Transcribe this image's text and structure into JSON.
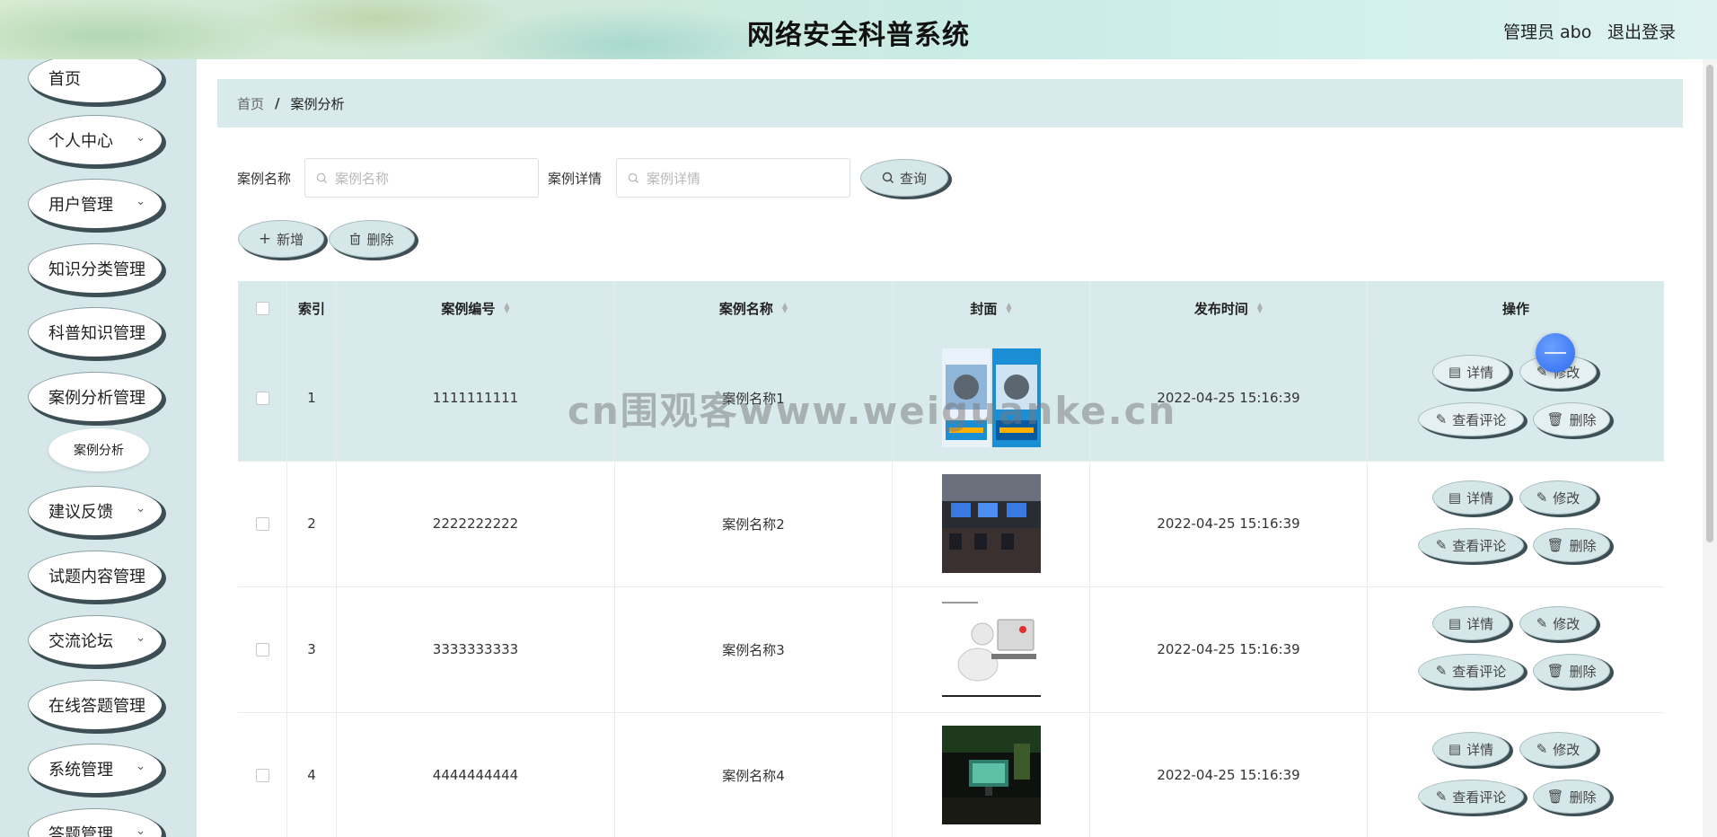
{
  "header": {
    "title": "网络安全科普系统",
    "user": "管理员 abo",
    "logout": "退出登录"
  },
  "sidebar": {
    "items": [
      {
        "label": "首页",
        "has_arrow": false
      },
      {
        "label": "个人中心",
        "has_arrow": true
      },
      {
        "label": "用户管理",
        "has_arrow": true
      },
      {
        "label": "知识分类管理",
        "has_arrow": false
      },
      {
        "label": "科普知识管理",
        "has_arrow": false
      },
      {
        "label": "案例分析管理",
        "has_arrow": false
      },
      {
        "label": "建议反馈",
        "has_arrow": true
      },
      {
        "label": "试题内容管理",
        "has_arrow": false
      },
      {
        "label": "交流论坛",
        "has_arrow": true
      },
      {
        "label": "在线答题管理",
        "has_arrow": false
      },
      {
        "label": "系统管理",
        "has_arrow": true
      },
      {
        "label": "答题管理",
        "has_arrow": true
      }
    ],
    "sub_item": "案例分析"
  },
  "breadcrumb": {
    "home": "首页",
    "separator": "/",
    "current": "案例分析"
  },
  "search": {
    "name_label": "案例名称",
    "name_placeholder": "案例名称",
    "detail_label": "案例详情",
    "detail_placeholder": "案例详情",
    "query_button": "查询"
  },
  "toolbar": {
    "add_button": "新增",
    "delete_button": "删除"
  },
  "table": {
    "headers": {
      "index": "索引",
      "code": "案例编号",
      "name": "案例名称",
      "cover": "封面",
      "time": "发布时间",
      "actions": "操作"
    },
    "rows": [
      {
        "index": "1",
        "code": "1111111111",
        "name": "案例名称1",
        "time": "2022-04-25 15:16:39"
      },
      {
        "index": "2",
        "code": "2222222222",
        "name": "案例名称2",
        "time": "2022-04-25 15:16:39"
      },
      {
        "index": "3",
        "code": "3333333333",
        "name": "案例名称3",
        "time": "2022-04-25 15:16:39"
      },
      {
        "index": "4",
        "code": "4444444444",
        "name": "案例名称4",
        "time": "2022-04-25 15:16:39"
      }
    ],
    "actions": {
      "detail": "详情",
      "edit": "修改",
      "comments": "查看评论",
      "delete": "删除"
    }
  },
  "watermark": "cn围观客www.weiguanke.cn",
  "colors": {
    "accent_bg": "#d8eaeb",
    "sidebar_bg": "#d5e7e9",
    "button_shadow": "#3d4f55"
  }
}
